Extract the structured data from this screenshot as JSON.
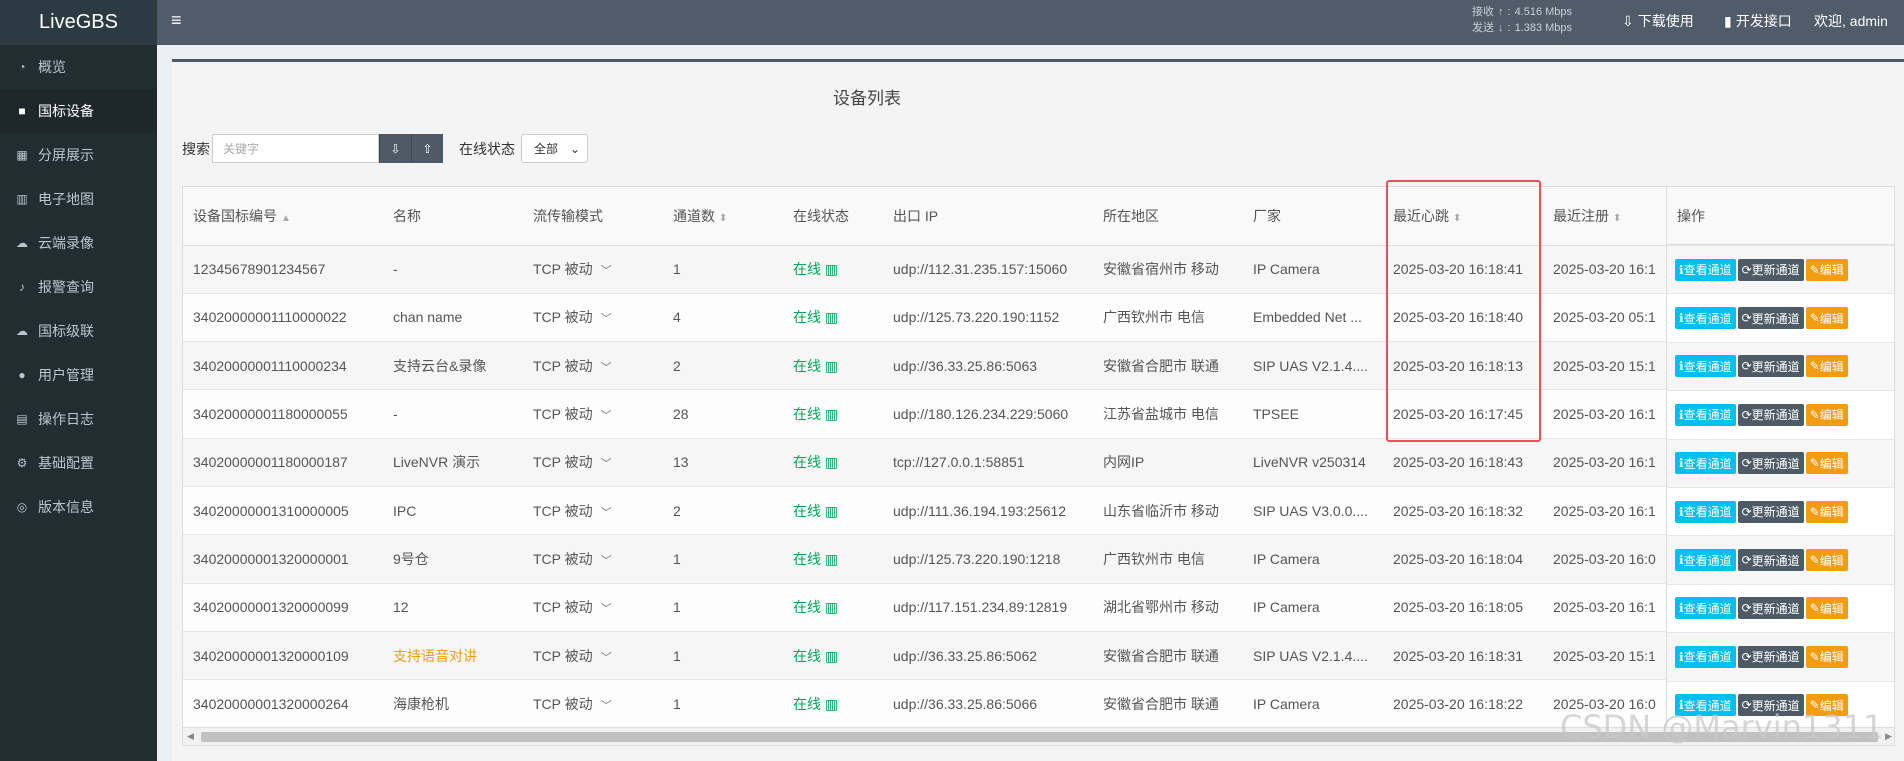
{
  "app": {
    "logo": "LiveGBS"
  },
  "sidebar": {
    "items": [
      {
        "label": "概览",
        "icon": "dashboard-icon"
      },
      {
        "label": "国标设备",
        "icon": "video-camera-icon",
        "active": true
      },
      {
        "label": "分屏展示",
        "icon": "grid-icon"
      },
      {
        "label": "电子地图",
        "icon": "map-icon"
      },
      {
        "label": "云端录像",
        "icon": "cloud-icon"
      },
      {
        "label": "报警查询",
        "icon": "bell-icon"
      },
      {
        "label": "国标级联",
        "icon": "cloud-upload-icon"
      },
      {
        "label": "用户管理",
        "icon": "users-icon"
      },
      {
        "label": "操作日志",
        "icon": "file-icon"
      },
      {
        "label": "基础配置",
        "icon": "gears-icon"
      },
      {
        "label": "版本信息",
        "icon": "info-globe-icon"
      }
    ]
  },
  "header": {
    "recv_label": "接收",
    "recv_value": "4.516 Mbps",
    "send_label": "发送",
    "send_value": "1.383 Mbps",
    "download": "下载使用",
    "api": "开发接口",
    "welcome": "欢迎, admin"
  },
  "main": {
    "title": "设备列表",
    "search_label": "搜索",
    "search_placeholder": "关键字",
    "status_label": "在线状态",
    "status_value": "全部"
  },
  "table": {
    "columns": [
      "设备国标编号",
      "名称",
      "流传输模式",
      "通道数",
      "在线状态",
      "出口 IP",
      "所在地区",
      "厂家",
      "最近心跳",
      "最近注册",
      "操作"
    ],
    "rows": [
      {
        "id": "12345678901234567",
        "name": "-",
        "mode": "TCP 被动",
        "channels": "1",
        "status": "在线",
        "ip": "udp://112.31.235.157:15060",
        "region": "安徽省宿州市 移动",
        "vendor": "IP Camera",
        "heartbeat": "2025-03-20 16:18:41",
        "register": "2025-03-20 16:1"
      },
      {
        "id": "34020000001110000022",
        "name": "chan name",
        "mode": "TCP 被动",
        "channels": "4",
        "status": "在线",
        "ip": "udp://125.73.220.190:1152",
        "region": "广西钦州市 电信",
        "vendor": "Embedded Net ...",
        "heartbeat": "2025-03-20 16:18:40",
        "register": "2025-03-20 05:1"
      },
      {
        "id": "34020000001110000234",
        "name": "支持云台&录像",
        "mode": "TCP 被动",
        "channels": "2",
        "status": "在线",
        "ip": "udp://36.33.25.86:5063",
        "region": "安徽省合肥市 联通",
        "vendor": "SIP UAS V2.1.4....",
        "heartbeat": "2025-03-20 16:18:13",
        "register": "2025-03-20 15:1"
      },
      {
        "id": "34020000001180000055",
        "name": "-",
        "mode": "TCP 被动",
        "channels": "28",
        "status": "在线",
        "ip": "udp://180.126.234.229:5060",
        "region": "江苏省盐城市 电信",
        "vendor": "TPSEE",
        "heartbeat": "2025-03-20 16:17:45",
        "register": "2025-03-20 16:1"
      },
      {
        "id": "34020000001180000187",
        "name": "LiveNVR 演示",
        "mode": "TCP 被动",
        "channels": "13",
        "status": "在线",
        "ip": "tcp://127.0.0.1:58851",
        "region": "内网IP",
        "vendor": "LiveNVR v250314",
        "heartbeat": "2025-03-20 16:18:43",
        "register": "2025-03-20 16:1"
      },
      {
        "id": "34020000001310000005",
        "name": "IPC",
        "mode": "TCP 被动",
        "channels": "2",
        "status": "在线",
        "ip": "udp://111.36.194.193:25612",
        "region": "山东省临沂市 移动",
        "vendor": "SIP UAS V3.0.0....",
        "heartbeat": "2025-03-20 16:18:32",
        "register": "2025-03-20 16:1"
      },
      {
        "id": "34020000001320000001",
        "name": "9号仓",
        "mode": "TCP 被动",
        "channels": "1",
        "status": "在线",
        "ip": "udp://125.73.220.190:1218",
        "region": "广西钦州市 电信",
        "vendor": "IP Camera",
        "heartbeat": "2025-03-20 16:18:04",
        "register": "2025-03-20 16:0"
      },
      {
        "id": "34020000001320000099",
        "name": "12",
        "mode": "TCP 被动",
        "channels": "1",
        "status": "在线",
        "ip": "udp://117.151.234.89:12819",
        "region": "湖北省鄂州市 移动",
        "vendor": "IP Camera",
        "heartbeat": "2025-03-20 16:18:05",
        "register": "2025-03-20 16:1"
      },
      {
        "id": "34020000001320000109",
        "name": "支持语音对讲",
        "mode": "TCP 被动",
        "channels": "1",
        "status": "在线",
        "ip": "udp://36.33.25.86:5062",
        "region": "安徽省合肥市 联通",
        "vendor": "SIP UAS V2.1.4....",
        "heartbeat": "2025-03-20 16:18:31",
        "register": "2025-03-20 15:1",
        "name_highlight": true
      },
      {
        "id": "34020000001320000264",
        "name": "海康枪机",
        "mode": "TCP 被动",
        "channels": "1",
        "status": "在线",
        "ip": "udp://36.33.25.86:5066",
        "region": "安徽省合肥市 联通",
        "vendor": "IP Camera",
        "heartbeat": "2025-03-20 16:18:22",
        "register": "2025-03-20 16:0"
      }
    ],
    "actions": {
      "view": "查看通道",
      "update": "更新通道",
      "edit": "编辑"
    }
  },
  "watermark": "CSDN @Marvin1311",
  "colors": {
    "sidebar": "#222d32",
    "header": "#505c69",
    "online": "#00a65a",
    "view_btn": "#00c0ef",
    "update_btn": "#4e5b66",
    "edit_btn": "#f39c12",
    "highlight_box": "#e8505b"
  }
}
